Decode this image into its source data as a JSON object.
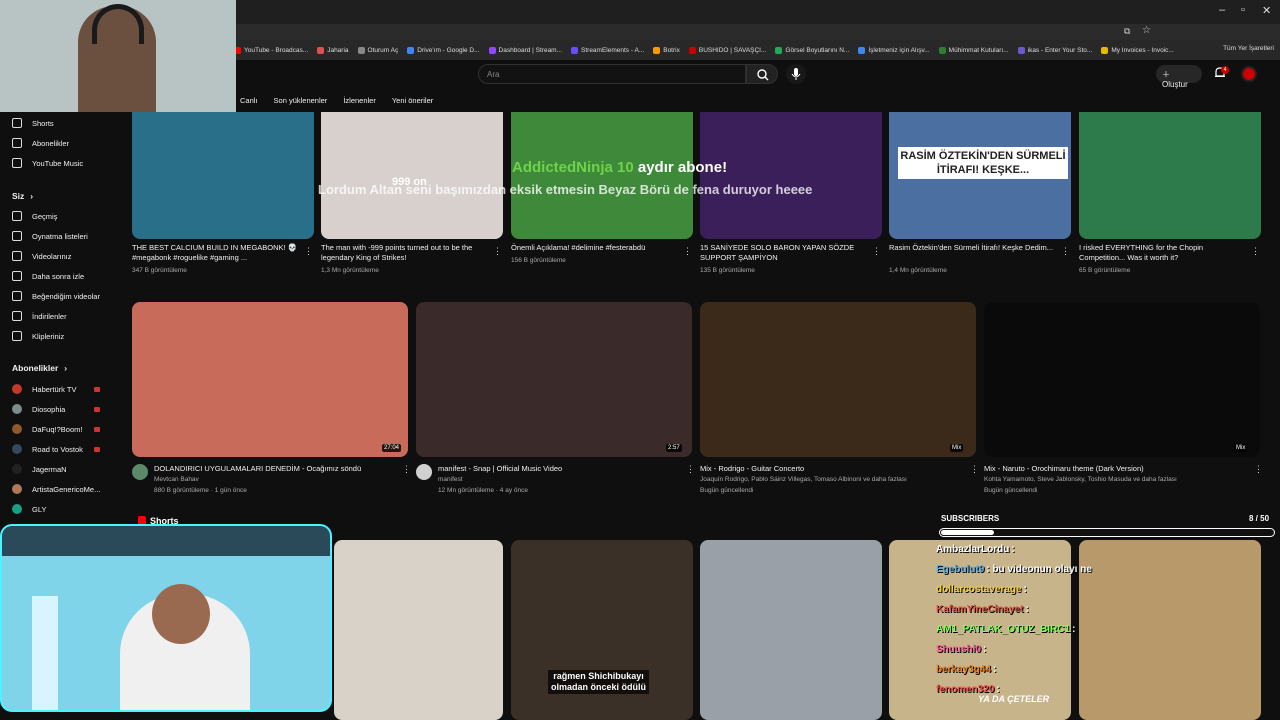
{
  "browser": {
    "bookmarks": [
      {
        "label": "YouTube - Broadcas...",
        "color": "#ff0000"
      },
      {
        "label": "Jaharia",
        "color": "#e05050"
      },
      {
        "label": "Oturum Aç",
        "color": "#888888"
      },
      {
        "label": "Drive'ım - Google D...",
        "color": "#4285f4"
      },
      {
        "label": "Dashboard | Stream...",
        "color": "#9146ff"
      },
      {
        "label": "StreamElements - A...",
        "color": "#6b4cff"
      },
      {
        "label": "Botrix",
        "color": "#ff9900"
      },
      {
        "label": "BUSHIDO | SAVAŞÇI...",
        "color": "#cc0000"
      },
      {
        "label": "Görsel Boyutlarını N...",
        "color": "#22aa55"
      },
      {
        "label": "İşletmeniz için Alışv...",
        "color": "#4285f4"
      },
      {
        "label": "Mühimmat Kutuları...",
        "color": "#2e7d32"
      },
      {
        "label": "ikas - Enter Your Sto...",
        "color": "#6a5acd"
      },
      {
        "label": "My Invoices - Invoic...",
        "color": "#e6b800"
      }
    ],
    "bookmarks_right": "Tüm Yer İşaretleri"
  },
  "header": {
    "search_placeholder": "Ara",
    "create_label": "Oluştur",
    "notification_count": "4"
  },
  "chips": [
    "Canlı",
    "Son yüklenenler",
    "İzlenenler",
    "Yeni öneriler"
  ],
  "sidebar": {
    "top_items": [
      {
        "label": "Shorts",
        "icon": "shorts-icon"
      },
      {
        "label": "Abonelikler",
        "icon": "subscriptions-icon"
      },
      {
        "label": "YouTube Music",
        "icon": "music-icon"
      }
    ],
    "you_heading": "Siz",
    "you_items": [
      {
        "label": "Geçmiş",
        "icon": "history-icon"
      },
      {
        "label": "Oynatma listeleri",
        "icon": "playlist-icon"
      },
      {
        "label": "Videolarınız",
        "icon": "video-icon"
      },
      {
        "label": "Daha sonra izle",
        "icon": "clock-icon"
      },
      {
        "label": "Beğendiğim videolar",
        "icon": "like-icon"
      },
      {
        "label": "İndirilenler",
        "icon": "download-icon"
      },
      {
        "label": "Klipleriniz",
        "icon": "scissors-icon"
      }
    ],
    "subs_heading": "Abonelikler",
    "subscriptions": [
      {
        "label": "Habertürk TV",
        "color": "#c0392b",
        "live": true
      },
      {
        "label": "Diosophia",
        "color": "#7f8c8d",
        "live": true
      },
      {
        "label": "DaFuq!?Boom!",
        "color": "#8e5a2b",
        "live": true
      },
      {
        "label": "Road to Vostok",
        "color": "#34495e",
        "live": true
      },
      {
        "label": "JagermaN",
        "color": "#222222",
        "live": false
      },
      {
        "label": "ArtistaGenericoMe...",
        "color": "#b0785a",
        "live": false
      },
      {
        "label": "GLY",
        "color": "#16a085",
        "live": false
      }
    ]
  },
  "row1": [
    {
      "title": "THE BEST CALCIUM BUILD IN MEGABONK! 💀#megabonk #roguelike #gaming ...",
      "meta": "347 B görüntüleme",
      "thumb": "#2a6f8a"
    },
    {
      "title": "The man with -999 points turned out to be the legendary King of Strikes!",
      "meta": "1,3 Mn görüntüleme",
      "thumb": "#d8d0cc"
    },
    {
      "title": "Önemli Açıklama! #delimine #festerabdü",
      "meta": "156 B görüntüleme",
      "thumb": "#3f8a3a"
    },
    {
      "title": "15 SANİYEDE SOLO BARON YAPAN SÖZDE SUPPORT ŞAMPİYON",
      "meta": "135 B görüntüleme",
      "thumb": "#3a1f5a"
    },
    {
      "title": "Rasim Öztekin'den Sürmeli İtirafı! Keşke Dedim...",
      "meta": "1,4 Mn görüntüleme",
      "thumb": "#4a6fa0"
    },
    {
      "title": "I risked EVERYTHING for the Chopin Competition... Was it worth it?",
      "meta": "65 B görüntüleme",
      "thumb": "#2d7a4a"
    }
  ],
  "row1_overlay": "RASİM ÖZTEKİN'DEN SÜRMELİ İTİRAFI! KEŞKE...",
  "row1_thumb_text": "999 on",
  "row2": [
    {
      "title": "DOLANDIRICI UYGULAMALARI DENEDİM - Ocağımız söndü",
      "channel": "Mevtcan Bahav",
      "meta": "880 B görüntüleme · 1 gün önce",
      "duration": "27:04",
      "thumb": "#c96b5a",
      "avatar": "#5a8a6a"
    },
    {
      "title": "manifest - Snap | Official Music Video",
      "channel": "manifest",
      "meta": "12 Mn görüntüleme · 4 ay önce",
      "duration": "2:57",
      "thumb": "#3a2a2a",
      "avatar": "#d0d0d0"
    },
    {
      "title": "Mix - Rodrigo - Guitar Concerto",
      "channel": "Joaquín Rodrigo, Pablo Sáinz Villegas, Tomaso Albinoni ve daha fazlası",
      "meta": "Bugün güncellendi",
      "duration": "Mix",
      "thumb": "#3b2a1a"
    },
    {
      "title": "Mix - Naruto - Orochimaru theme (Dark Version)",
      "channel": "Kohta Yamamoto, Steve Jablonsky, Toshio Masuda ve daha fazlası",
      "meta": "Bugün güncellendi",
      "duration": "Mix",
      "thumb": "#0a0a0a"
    }
  ],
  "shorts_heading": "Shorts",
  "shorts": [
    {
      "thumb": "#d8d2c8"
    },
    {
      "thumb": "#3a3028"
    },
    {
      "thumb": "#9aa0a8"
    },
    {
      "thumb": "#c8b48a"
    }
  ],
  "stream_overlay": {
    "alert_name": "AddictedNinja",
    "alert_count": "10",
    "alert_rest": "aydır abone!",
    "alert_message": "Lordum Altan seni başımızdan eksik etmesin Beyaz Börü de fena duruyor heeee",
    "subscribers_label": "SUBSCRIBERS",
    "subscribers_count": "8 / 50",
    "subscribers_progress": 0.16,
    "short_caption": [
      "rağmen Shichibukayı",
      "olmadan önceki ödülü"
    ],
    "game_caption": "YA DA ÇETELER"
  },
  "chat": [
    {
      "user": "AmbazlarLordu",
      "msg": ":",
      "color": "#ffffff"
    },
    {
      "user": "Egebulut9",
      "msg": ": bu videonun olayı ne",
      "color": "#5dade2"
    },
    {
      "user": "dollarcostaverage",
      "msg": ":",
      "color": "#f4d03f"
    },
    {
      "user": "KafamYineCinayet",
      "msg": ":",
      "color": "#e74c3c"
    },
    {
      "user": "AM1_PATLAK_OTUZ_BIRC1",
      "msg": ":",
      "color": "#7dff5a"
    },
    {
      "user": "Shuushi0",
      "msg": ":",
      "color": "#ff5a9a"
    },
    {
      "user": "berkay3g44",
      "msg": ":",
      "color": "#e67e22"
    },
    {
      "user": "fenomen320",
      "msg": ":",
      "color": "#ff4d4d"
    }
  ]
}
